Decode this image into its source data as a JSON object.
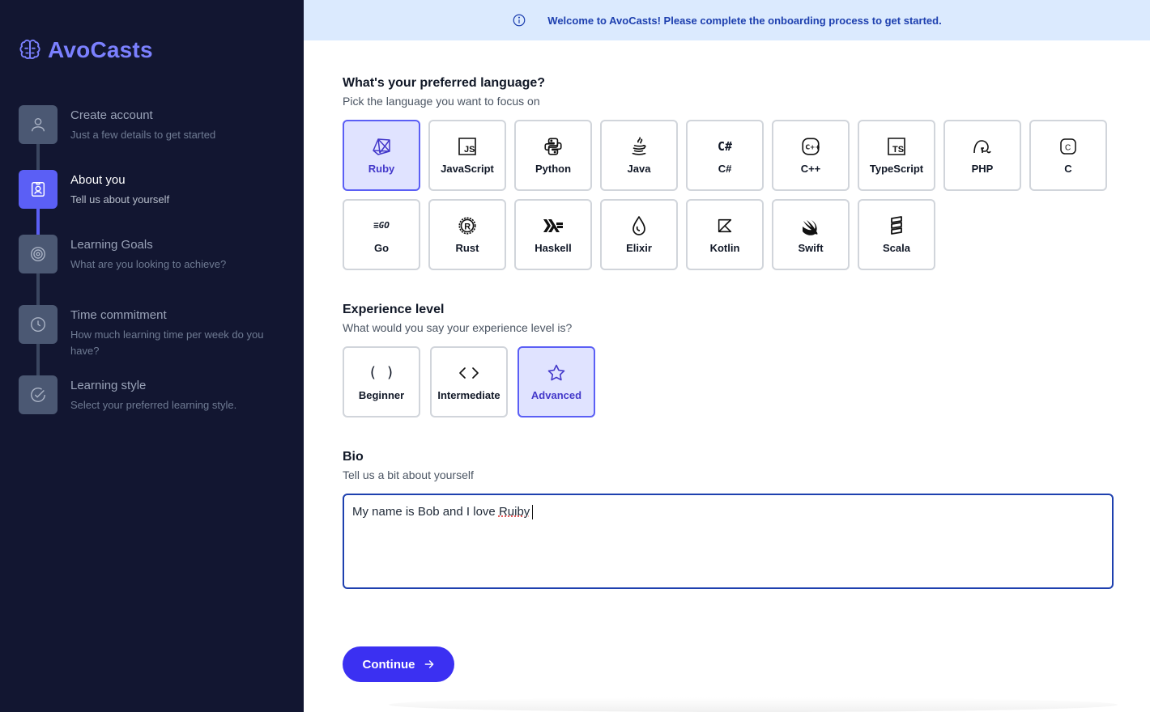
{
  "app": {
    "name": "AvoCasts"
  },
  "banner": {
    "text": "Welcome to AvoCasts! Please complete the onboarding process to get started."
  },
  "steps": [
    {
      "title": "Create account",
      "desc": "Just a few details to get started",
      "icon": "user-icon",
      "state": "done"
    },
    {
      "title": "About you",
      "desc": "Tell us about yourself",
      "icon": "id-badge-icon",
      "state": "active"
    },
    {
      "title": "Learning Goals",
      "desc": "What are you looking to achieve?",
      "icon": "target-icon",
      "state": "pending"
    },
    {
      "title": "Time commitment",
      "desc": "How much learning time per week do you have?",
      "icon": "clock-icon",
      "state": "pending"
    },
    {
      "title": "Learning style",
      "desc": "Select your preferred learning style.",
      "icon": "check-circle-icon",
      "state": "pending"
    }
  ],
  "language": {
    "title": "What's your preferred language?",
    "subtitle": "Pick the language you want to focus on",
    "selected": "Ruby",
    "options": [
      {
        "label": "Ruby",
        "icon": "ruby-icon"
      },
      {
        "label": "JavaScript",
        "icon": "javascript-icon",
        "glyph": "JS"
      },
      {
        "label": "Python",
        "icon": "python-icon"
      },
      {
        "label": "Java",
        "icon": "java-icon"
      },
      {
        "label": "C#",
        "icon": "csharp-icon",
        "glyph": "C#"
      },
      {
        "label": "C++",
        "icon": "cpp-icon",
        "glyph": "C++"
      },
      {
        "label": "TypeScript",
        "icon": "typescript-icon",
        "glyph": "TS"
      },
      {
        "label": "PHP",
        "icon": "php-icon"
      },
      {
        "label": "C",
        "icon": "c-icon",
        "glyph": "C"
      },
      {
        "label": "Go",
        "icon": "go-icon",
        "glyph": "≡GO"
      },
      {
        "label": "Rust",
        "icon": "rust-icon",
        "glyph": "R"
      },
      {
        "label": "Haskell",
        "icon": "haskell-icon"
      },
      {
        "label": "Elixir",
        "icon": "elixir-icon"
      },
      {
        "label": "Kotlin",
        "icon": "kotlin-icon"
      },
      {
        "label": "Swift",
        "icon": "swift-icon"
      },
      {
        "label": "Scala",
        "icon": "scala-icon"
      }
    ]
  },
  "experience": {
    "title": "Experience level",
    "subtitle": "What would you say your experience level is?",
    "selected": "Advanced",
    "options": [
      {
        "label": "Beginner",
        "icon": "parentheses-icon",
        "glyph": "( )"
      },
      {
        "label": "Intermediate",
        "icon": "code-brackets-icon",
        "glyph": "< >"
      },
      {
        "label": "Advanced",
        "icon": "star-icon"
      }
    ]
  },
  "bio": {
    "title": "Bio",
    "subtitle": "Tell us a bit about yourself",
    "value_prefix": "My name is Bob and I love ",
    "value_misspelled": "Ruiby"
  },
  "continue_label": "Continue",
  "colors": {
    "sidebar": "#121631",
    "accent": "#5b5ff5",
    "button": "#3b30f2",
    "banner_bg": "#dbeafe",
    "banner_text": "#1e40af"
  }
}
